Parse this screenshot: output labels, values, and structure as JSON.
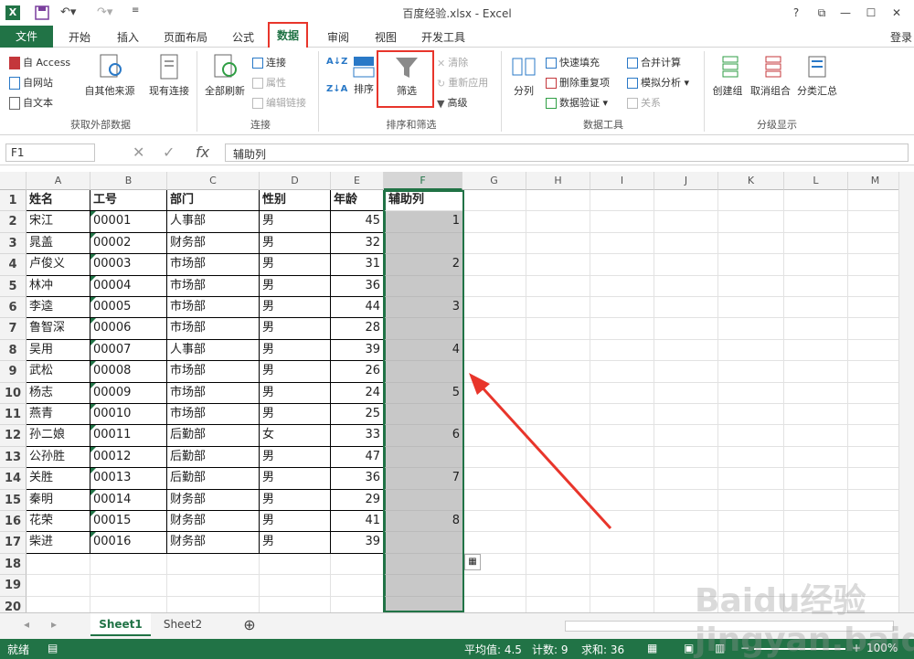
{
  "window": {
    "title": "百度经验.xlsx - Excel",
    "help": "?",
    "login": "登录"
  },
  "tabs": {
    "file": "文件",
    "items": [
      "开始",
      "插入",
      "页面布局",
      "公式",
      "数据",
      "审阅",
      "视图",
      "开发工具"
    ],
    "active": "数据"
  },
  "ribbon": {
    "ext_data": {
      "access": "自 Access",
      "web": "自网站",
      "text": "自文本",
      "other": "自其他来源",
      "existing": "现有连接",
      "group": "获取外部数据"
    },
    "connections": {
      "refresh": "全部刷新",
      "connect": "连接",
      "properties": "属性",
      "edit_links": "编辑链接",
      "group": "连接"
    },
    "sort_filter": {
      "sort": "排序",
      "filter": "筛选",
      "clear": "清除",
      "reapply": "重新应用",
      "advanced": "高级",
      "group": "排序和筛选"
    },
    "data_tools": {
      "split": "分列",
      "flash_fill": "快速填充",
      "remove_dup": "删除重复项",
      "validation": "数据验证",
      "consolidate": "合并计算",
      "what_if": "模拟分析",
      "relations": "关系",
      "group": "数据工具"
    },
    "outline": {
      "group_btn": "创建组",
      "ungroup": "取消组合",
      "subtotal": "分类汇总",
      "group": "分级显示"
    }
  },
  "formula_bar": {
    "name_box": "F1",
    "cancel": "✕",
    "enter": "✓",
    "fx": "fx",
    "value": "辅助列"
  },
  "columns": [
    "A",
    "B",
    "C",
    "D",
    "E",
    "F",
    "G",
    "H",
    "I",
    "J",
    "K",
    "L",
    "M"
  ],
  "rows": [
    "1",
    "2",
    "3",
    "4",
    "5",
    "6",
    "7",
    "8",
    "9",
    "10",
    "11",
    "12",
    "13",
    "14",
    "15",
    "16",
    "17",
    "18",
    "19",
    "20"
  ],
  "table": {
    "header": [
      "姓名",
      "工号",
      "部门",
      "性别",
      "年龄",
      "辅助列"
    ],
    "data": [
      [
        "宋江",
        "00001",
        "人事部",
        "男",
        "45",
        "1"
      ],
      [
        "晁盖",
        "00002",
        "财务部",
        "男",
        "32",
        ""
      ],
      [
        "卢俊义",
        "00003",
        "市场部",
        "男",
        "31",
        "2"
      ],
      [
        "林冲",
        "00004",
        "市场部",
        "男",
        "36",
        ""
      ],
      [
        "李逵",
        "00005",
        "市场部",
        "男",
        "44",
        "3"
      ],
      [
        "鲁智深",
        "00006",
        "市场部",
        "男",
        "28",
        ""
      ],
      [
        "吴用",
        "00007",
        "人事部",
        "男",
        "39",
        "4"
      ],
      [
        "武松",
        "00008",
        "市场部",
        "男",
        "26",
        ""
      ],
      [
        "杨志",
        "00009",
        "市场部",
        "男",
        "24",
        "5"
      ],
      [
        "燕青",
        "00010",
        "市场部",
        "男",
        "25",
        ""
      ],
      [
        "孙二娘",
        "00011",
        "后勤部",
        "女",
        "33",
        "6"
      ],
      [
        "公孙胜",
        "00012",
        "后勤部",
        "男",
        "47",
        ""
      ],
      [
        "关胜",
        "00013",
        "后勤部",
        "男",
        "36",
        "7"
      ],
      [
        "秦明",
        "00014",
        "财务部",
        "男",
        "29",
        ""
      ],
      [
        "花荣",
        "00015",
        "财务部",
        "男",
        "41",
        "8"
      ],
      [
        "柴进",
        "00016",
        "财务部",
        "男",
        "39",
        ""
      ]
    ]
  },
  "sheets": [
    "Sheet1",
    "Sheet2"
  ],
  "active_sheet": "Sheet1",
  "status": {
    "mode": "就绪",
    "avg": "平均值: 4.5",
    "count": "计数: 9",
    "sum": "求和: 36",
    "zoom": "100%"
  },
  "watermark": "Baidu经验 jingyan.baidu.com",
  "colors": {
    "accent": "#217346",
    "highlight": "#e8352b",
    "selection": "#c8c8c8"
  }
}
